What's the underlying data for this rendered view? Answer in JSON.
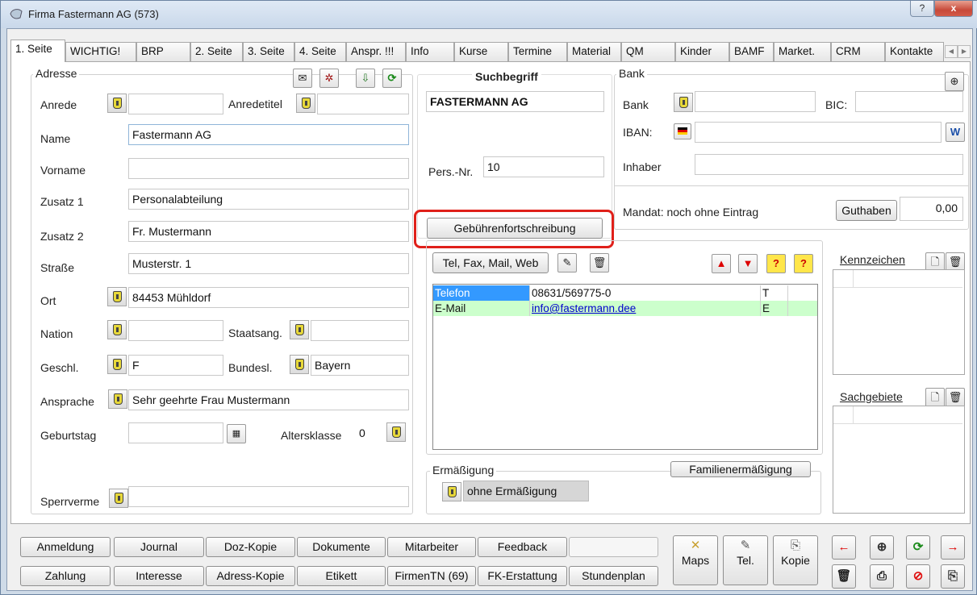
{
  "window": {
    "title": "Firma Fastermann AG (573)",
    "help": "?",
    "close": "x"
  },
  "tabs": [
    "1. Seite",
    "WICHTIG!",
    "BRP",
    "2. Seite",
    "3. Seite",
    "4. Seite",
    "Anspr. !!!",
    "Info",
    "Kurse",
    "Termine",
    "Material",
    "QM",
    "Kinder",
    "BAMF",
    "Market.",
    "CRM",
    "Kontakte"
  ],
  "adresse": {
    "group_label": "Adresse",
    "anrede": {
      "label": "Anrede",
      "value": ""
    },
    "anredetitel": {
      "label": "Anredetitel",
      "value": ""
    },
    "name": {
      "label": "Name",
      "value": "Fastermann AG"
    },
    "vorname": {
      "label": "Vorname",
      "value": ""
    },
    "zusatz1": {
      "label": "Zusatz 1",
      "value": "Personalabteilung"
    },
    "zusatz2": {
      "label": "Zusatz 2",
      "value": "Fr. Mustermann"
    },
    "strasse": {
      "label": "Straße",
      "value": "Musterstr. 1"
    },
    "ort": {
      "label": "Ort",
      "value": "84453 Mühldorf"
    },
    "nation": {
      "label": "Nation",
      "value": ""
    },
    "staatsang": {
      "label": "Staatsang.",
      "value": ""
    },
    "geschl": {
      "label": "Geschl.",
      "value": "F"
    },
    "bundesl": {
      "label": "Bundesl.",
      "value": "Bayern"
    },
    "ansprache": {
      "label": "Ansprache",
      "value": "Sehr geehrte Frau Mustermann"
    },
    "geburtstag": {
      "label": "Geburtstag",
      "value": ""
    },
    "altersklasse": {
      "label": "Altersklasse",
      "value": "0"
    },
    "sperrvermerk": {
      "label": "Sperrverme",
      "value": ""
    }
  },
  "suchbegriff": {
    "label": "Suchbegriff",
    "value": "FASTERMANN AG"
  },
  "persnr": {
    "label": "Pers.-Nr.",
    "value": "10"
  },
  "gebuehren_button": "Gebührenfortschreibung",
  "bank": {
    "group_label": "Bank",
    "bank": {
      "label": "Bank",
      "value": ""
    },
    "bic": {
      "label": "BIC:",
      "value": ""
    },
    "iban": {
      "label": "IBAN:",
      "value": ""
    },
    "inhaber": {
      "label": "Inhaber",
      "value": ""
    },
    "mandat": "Mandat: noch ohne Eintrag",
    "guthaben_button": "Guthaben",
    "guthaben_value": "0,00"
  },
  "communication": {
    "button": "Tel, Fax, Mail, Web",
    "rows": [
      {
        "type": "Telefon",
        "value": "08631/569775-0",
        "code": "T"
      },
      {
        "type": "E-Mail",
        "value": "info@fastermann.dee",
        "code": "E"
      }
    ]
  },
  "ermaessigung": {
    "label": "Ermäßigung",
    "button": "Familienermäßigung",
    "value": "ohne Ermäßigung"
  },
  "kennzeichen": {
    "label": "Kennzeichen"
  },
  "sachgebiete": {
    "label": "Sachgebiete"
  },
  "bottom": {
    "row1": [
      "Anmeldung",
      "Journal",
      "Doz-Kopie",
      "Dokumente",
      "Mitarbeiter",
      "Feedback",
      ""
    ],
    "row2": [
      "Zahlung",
      "Interesse",
      "Adress-Kopie",
      "Etikett",
      "FirmenTN (69)",
      "FK-Erstattung",
      "Stundenplan"
    ],
    "maps": "Maps",
    "tel": "Tel.",
    "kopie": "Kopie"
  },
  "colors": {
    "highlight": "#e0201a",
    "selected_row": "#3399ff",
    "email_row": "#ccffcc"
  }
}
